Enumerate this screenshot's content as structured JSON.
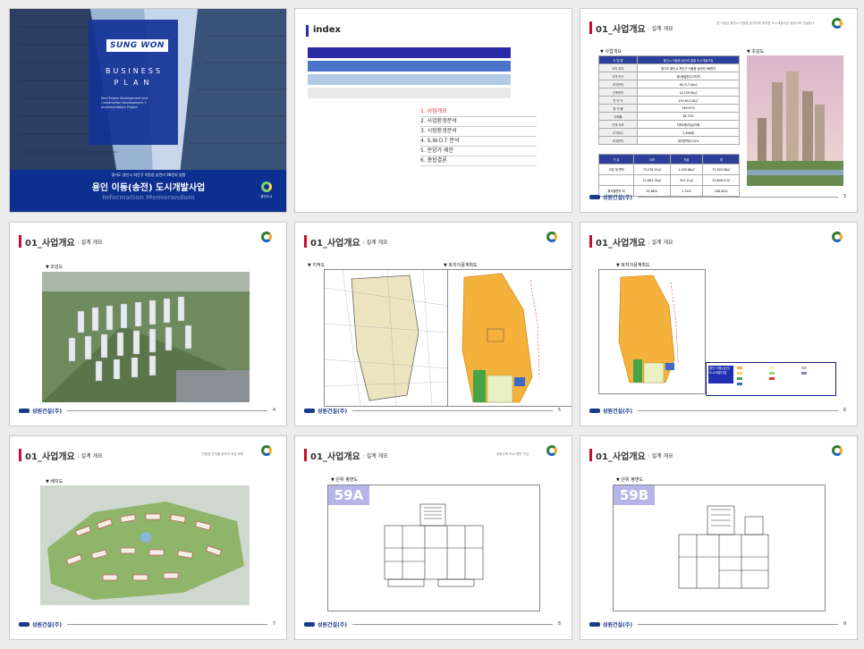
{
  "slides": [
    {
      "brand_logo": "SUNG WON",
      "heading_lines": [
        "BUSINESS",
        "PLAN"
      ],
      "desc": "Real Estate Development and Construction Development + Implementation Project",
      "kicker": "경기도 용인시 처인구 이동읍 송전리 96번지 일원",
      "main_title": "용인 이동(송전) 도시개발사업",
      "subtitle": "Information Memorandum",
      "org_mark": "용인도시"
    },
    {
      "index_title": "index",
      "items": [
        {
          "label": "1. 사업개요",
          "active": true
        },
        {
          "label": "2. 사업환경분석",
          "active": false
        },
        {
          "label": "3. 시장환경분석",
          "active": false
        },
        {
          "label": "4. S.W.O.T 분석",
          "active": false
        },
        {
          "label": "5. 분양가 제안",
          "active": false
        },
        {
          "label": "6. 종합결론",
          "active": false
        }
      ],
      "bar_colors": [
        "#2b2ba8",
        "#4a73c9",
        "#b4cbe8",
        "#e9e9e9"
      ]
    },
    {
      "section_num": "01_사업개요",
      "section_sub": ": 설계 개요",
      "note": "본 사업은 용인시 이동읍 송전리에 위치한 도시개발사업 공동주택 건설공사",
      "left_label": "▼ 사업개요",
      "right_label": "▼ 조감도",
      "table_rows": [
        [
          "사 업 명",
          "용인시 이동읍 송전리 일원 도시개발사업"
        ],
        [
          "대지 위치",
          "경기도 용인시 처인구 이동읍 송전리 96번지"
        ],
        [
          "지역 지구",
          "제2종일반주거지역"
        ],
        [
          "대지면적",
          "96,717.00㎡"
        ],
        [
          "건축면적",
          "14,159.90㎡"
        ],
        [
          "연 면 적",
          "255,613.40㎡"
        ],
        [
          "용 적 률",
          "199.97%"
        ],
        [
          "건폐율",
          "18.72%"
        ],
        [
          "건축 규모",
          "지하2층/지상25층"
        ],
        [
          "주차대수",
          "1,906대"
        ],
        [
          "조경면적",
          "대지면적의 15%"
        ]
      ],
      "sub_table": {
        "head": [
          "구 분",
          "지하",
          "지상",
          "계"
        ],
        "rows": [
          [
            "사업 계 면적",
            "75,578.30㎡",
            "1,935.86㎡",
            "77,303.56㎡"
          ],
          [
            "",
            "22,061.16㎡",
            "547.11㎡",
            "23,608.27㎡"
          ],
          [
            "용도별면적 비",
            "91.66%",
            "2.74%",
            "100.00%"
          ]
        ]
      },
      "page": "3"
    },
    {
      "section_num": "01_사업개요",
      "section_sub": ": 설계 개요",
      "label": "▼ 조감도",
      "page": "4"
    },
    {
      "section_num": "01_사업개요",
      "section_sub": ": 설계 개요",
      "label_left": "▼ 지적도",
      "label_right": "▼ 토지이용계획도",
      "page": "5"
    },
    {
      "section_num": "01_사업개요",
      "section_sub": ": 설계 개요",
      "label": "▼ 토지이용계획도",
      "legend_box": "용인 이동(송전) 도시개발사업",
      "page": "6"
    },
    {
      "section_num": "01_사업개요",
      "section_sub": ": 설계 개요",
      "label": "▼ 배치도",
      "note": "친환경 단지를 위하여 조경 계획",
      "page": "7"
    },
    {
      "section_num": "01_사업개요",
      "section_sub": ": 설계 개요",
      "label": "▼ 단위 평면도",
      "note": "공동주택 59A 평면 구성",
      "unit": "59A",
      "page": "8"
    },
    {
      "section_num": "01_사업개요",
      "section_sub": ": 설계 개요",
      "label": "▼ 단위 평면도",
      "unit": "59B",
      "page": "9"
    }
  ],
  "company": "성원건설(주)"
}
